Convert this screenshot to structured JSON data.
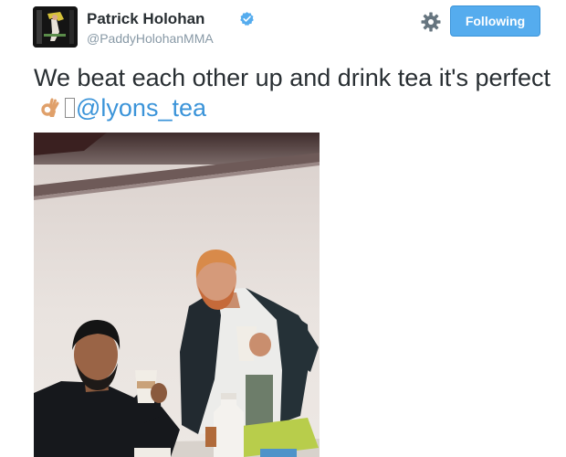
{
  "user": {
    "display_name": "Patrick Holohan",
    "screen_name": "@PaddyHolohanMMA",
    "verified": true
  },
  "actions": {
    "follow_label": "Following",
    "settings_icon": "gear-icon"
  },
  "tweet": {
    "text_main": "We beat each other up and drink tea it's perfect",
    "emoji": "ok-hand-icon",
    "mention": "@lyons_tea"
  },
  "colors": {
    "follow_button": "#55acee",
    "mention": "#3b94d9",
    "text": "#292f33",
    "muted": "#8899a6"
  }
}
